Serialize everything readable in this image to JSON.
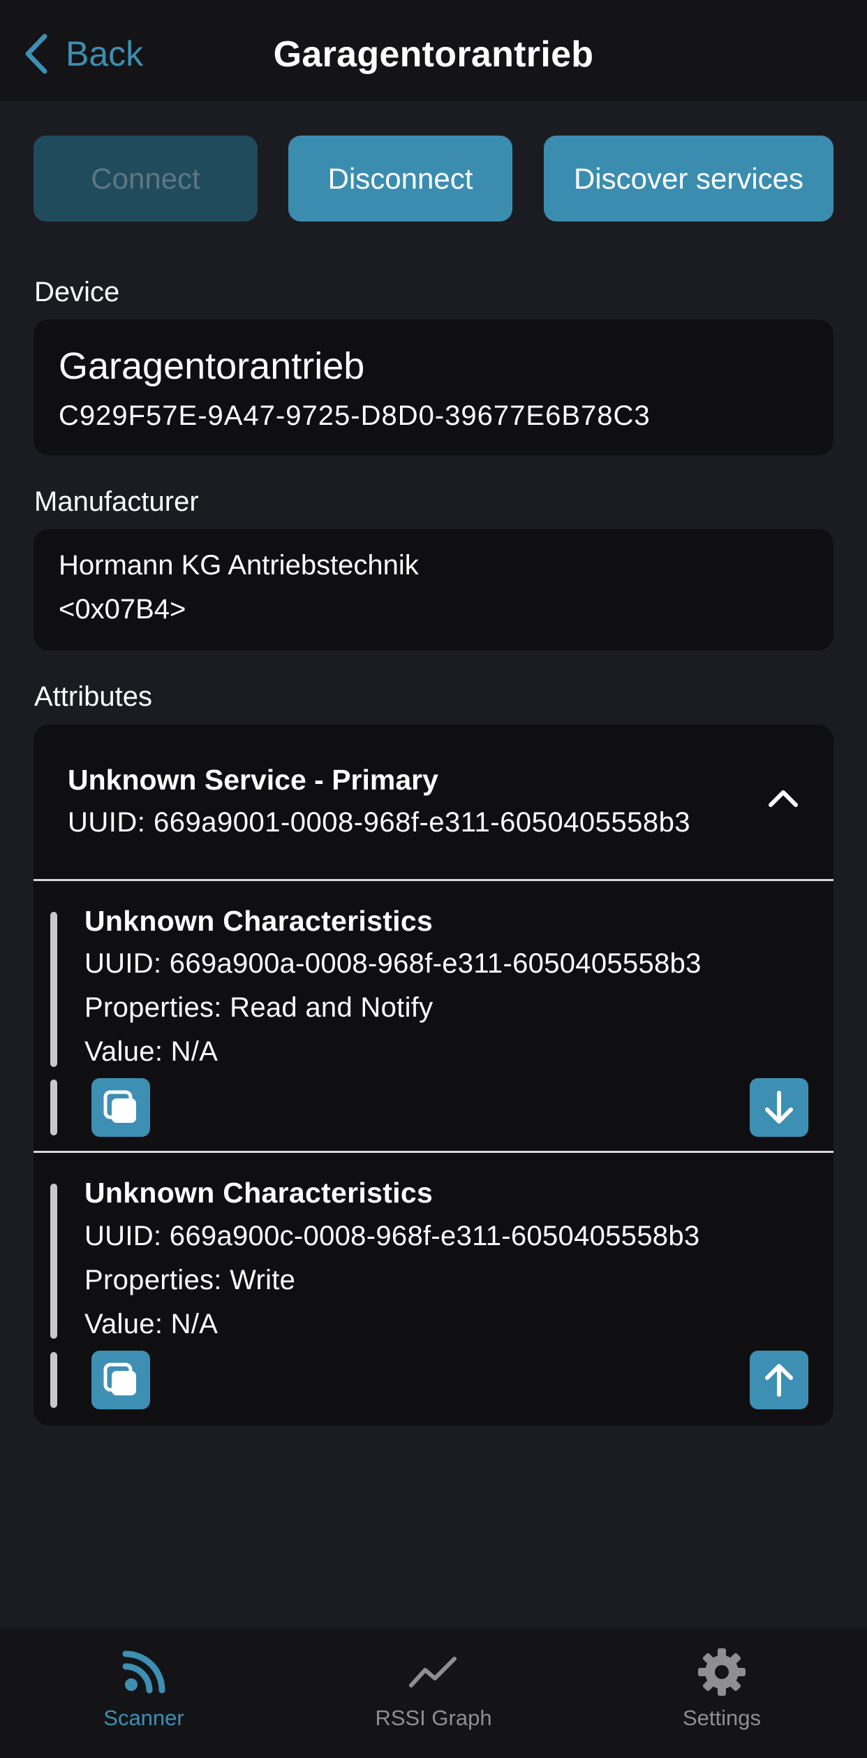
{
  "nav": {
    "back_label": "Back",
    "title": "Garagentorantrieb"
  },
  "actions": {
    "connect": "Connect",
    "disconnect": "Disconnect",
    "discover": "Discover services"
  },
  "device": {
    "section_label": "Device",
    "name": "Garagentorantrieb",
    "id": "C929F57E-9A47-9725-D8D0-39677E6B78C3"
  },
  "manufacturer": {
    "section_label": "Manufacturer",
    "name": "Hormann KG Antriebstechnik",
    "code": "<0x07B4>"
  },
  "attributes": {
    "section_label": "Attributes",
    "service": {
      "title": "Unknown Service - Primary",
      "uuid": "UUID: 669a9001-0008-968f-e311-6050405558b3",
      "expanded": true
    },
    "characteristics": [
      {
        "title": "Unknown Characteristics",
        "uuid": "UUID: 669a900a-0008-968f-e311-6050405558b3",
        "properties": "Properties: Read and Notify",
        "value": "Value: N/A",
        "action_icon": "arrow-down-icon"
      },
      {
        "title": "Unknown Characteristics",
        "uuid": "UUID: 669a900c-0008-968f-e311-6050405558b3",
        "properties": "Properties: Write",
        "value": "Value: N/A",
        "action_icon": "arrow-up-icon"
      }
    ]
  },
  "tabs": [
    {
      "label": "Scanner",
      "icon": "rss-signal-icon",
      "active": true
    },
    {
      "label": "RSSI Graph",
      "icon": "line-graph-icon",
      "active": false
    },
    {
      "label": "Settings",
      "icon": "gear-icon",
      "active": false
    }
  ],
  "colors": {
    "accent": "#3d8fb3",
    "background": "#1b1c22",
    "card": "#0f0f11",
    "bar": "#141416",
    "inactive": "#8e8e93"
  }
}
